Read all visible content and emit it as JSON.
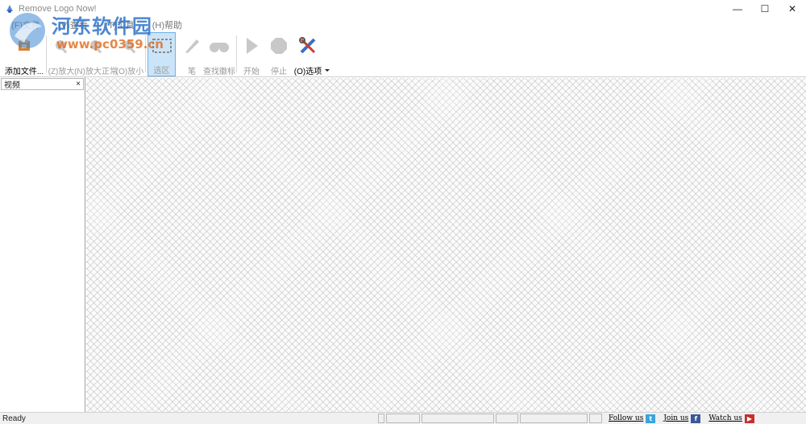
{
  "window": {
    "title": "Remove Logo Now!",
    "minimize": "—",
    "maximize": "☐",
    "close": "✕"
  },
  "menu": [
    "(F)文件",
    "(V)查看",
    "(T)工具",
    "(H)帮助"
  ],
  "watermark": {
    "text": "河东软件园",
    "url": "www.pc0359.cn"
  },
  "toolbar": {
    "add_file": "添加文件...",
    "zoom_in": "(Z)放大",
    "zoom_normal": "(N)放大正常",
    "zoom_out": "(O)放小",
    "select": "选区",
    "pen": "笔",
    "find_logo": "查找徽标",
    "start": "开始",
    "stop": "停止",
    "options": "(O)选项"
  },
  "panel": {
    "tab_label": "视频",
    "close": "×"
  },
  "status": {
    "text": "Ready",
    "follow": "Follow us",
    "join": "Join us",
    "watch": "Watch us"
  },
  "colors": {
    "selected_bg": "#cce4f7",
    "selected_border": "#6fb0e6",
    "watermark_blue": "#2f74c9",
    "watermark_orange": "#e06a1a"
  }
}
